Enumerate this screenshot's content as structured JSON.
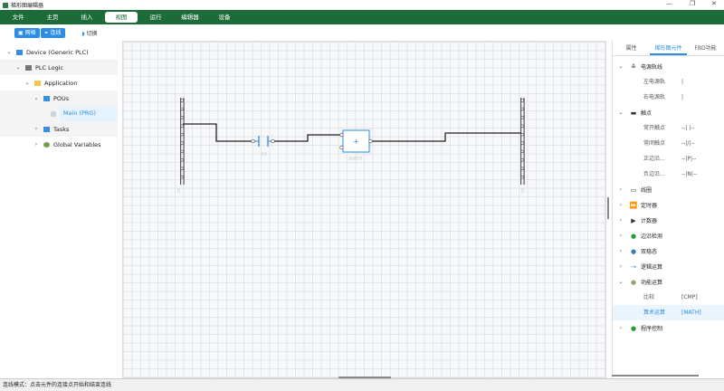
{
  "window": {
    "title": "梯形图编辑器",
    "minimize": "—",
    "maximize": "❐",
    "close": "✕"
  },
  "menu": [
    "文件",
    "主页",
    "插入",
    "视图",
    "运行",
    "编辑器",
    "设备"
  ],
  "menu_active": 3,
  "toolbar": {
    "grid": "网格",
    "wire": "连线",
    "toggle": "切换"
  },
  "tree": [
    {
      "label": "Device (Generic PLC)",
      "icon": "device-icon"
    },
    {
      "label": "PLC Logic",
      "icon": "plc-logic-icon"
    },
    {
      "label": "Application",
      "icon": "folder-icon"
    },
    {
      "label": "POUs",
      "icon": "folder-icon"
    },
    {
      "label": "Main (PRG)",
      "icon": "file-icon"
    },
    {
      "label": "Tasks",
      "icon": "folder-icon"
    },
    {
      "label": "Global Variables",
      "icon": "globe-icon"
    }
  ],
  "diagram": {
    "left_rail": "左",
    "right_rail": "右",
    "contact": "X0",
    "block": "MATH",
    "block_symbol": "+"
  },
  "panel": {
    "tabs": [
      "属性",
      "梯形图元件",
      "FBD功能"
    ],
    "active_tab": 1,
    "groups": [
      {
        "label": "电源轨线",
        "icon": "rail-icon",
        "glyph": "≚",
        "expanded": true,
        "items": [
          {
            "name": "左电源轨",
            "sym": "|"
          },
          {
            "name": "右电源轨",
            "sym": "|"
          }
        ]
      },
      {
        "label": "触点",
        "icon": "contact-icon",
        "glyph": "▬",
        "expanded": true,
        "items": [
          {
            "name": "常开触点",
            "sym": "--| |--"
          },
          {
            "name": "常闭触点",
            "sym": "--|/|--"
          },
          {
            "name": "正边沿...",
            "sym": "--|P|--"
          },
          {
            "name": "负边沿...",
            "sym": "--|N|--"
          }
        ]
      },
      {
        "label": "线圈",
        "icon": "coil-icon",
        "glyph": "▭"
      },
      {
        "label": "定时器",
        "icon": "timer-icon",
        "glyph": "⏩"
      },
      {
        "label": "计数器",
        "icon": "counter-icon",
        "glyph": "▶"
      },
      {
        "label": "边沿检测",
        "icon": "edge-icon",
        "glyph": "●"
      },
      {
        "label": "双稳态",
        "icon": "bistable-icon",
        "glyph": "●"
      },
      {
        "label": "逻辑运算",
        "icon": "logic-icon",
        "glyph": "→"
      },
      {
        "label": "功能运算",
        "icon": "function-icon",
        "glyph": "●",
        "expanded": true,
        "items": [
          {
            "name": "比较",
            "sym": "[CMP]"
          },
          {
            "name": "算术运算",
            "sym": "[MATH]"
          }
        ]
      },
      {
        "label": "程序控制",
        "icon": "program-control-icon",
        "glyph": "●"
      }
    ]
  },
  "status": "连线模式：点击元件的连接点开始和结束连线",
  "colors": {
    "accent": "#2b8de6",
    "menubar": "#1e6b3a"
  }
}
